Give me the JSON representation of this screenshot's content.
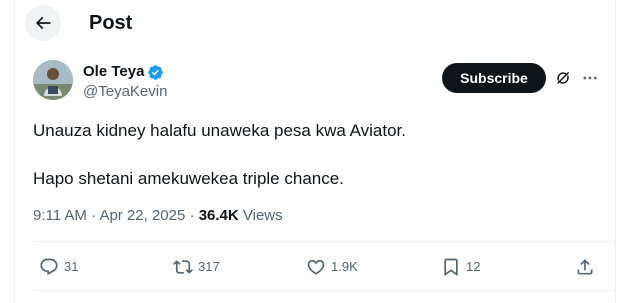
{
  "header": {
    "title": "Post",
    "back_icon": "arrow-left-icon"
  },
  "author": {
    "name": "Ole Teya",
    "handle": "@TeyaKevin",
    "verified_color": "#1d9bf0"
  },
  "actions_top": {
    "subscribe_label": "Subscribe",
    "grok_icon": "grok-icon",
    "more_icon": "more-horizontal-icon"
  },
  "tweet": {
    "line1": "Unauza kidney halafu unaweka pesa kwa Aviator.",
    "line2": "Hapo shetani amekuwekea triple chance."
  },
  "meta": {
    "time": "9:11 AM",
    "separator1": " · ",
    "date": "Apr 22, 2025",
    "separator2": " · ",
    "views_count": "36.4K",
    "views_label": " Views"
  },
  "engagement": {
    "replies": "31",
    "reposts": "317",
    "likes": "1.9K",
    "bookmarks": "12",
    "share_icon": "share-icon"
  },
  "colors": {
    "text_primary": "#0f1419",
    "text_secondary": "#536471",
    "divider": "#eff3f4",
    "button_dark": "#0f1419"
  }
}
